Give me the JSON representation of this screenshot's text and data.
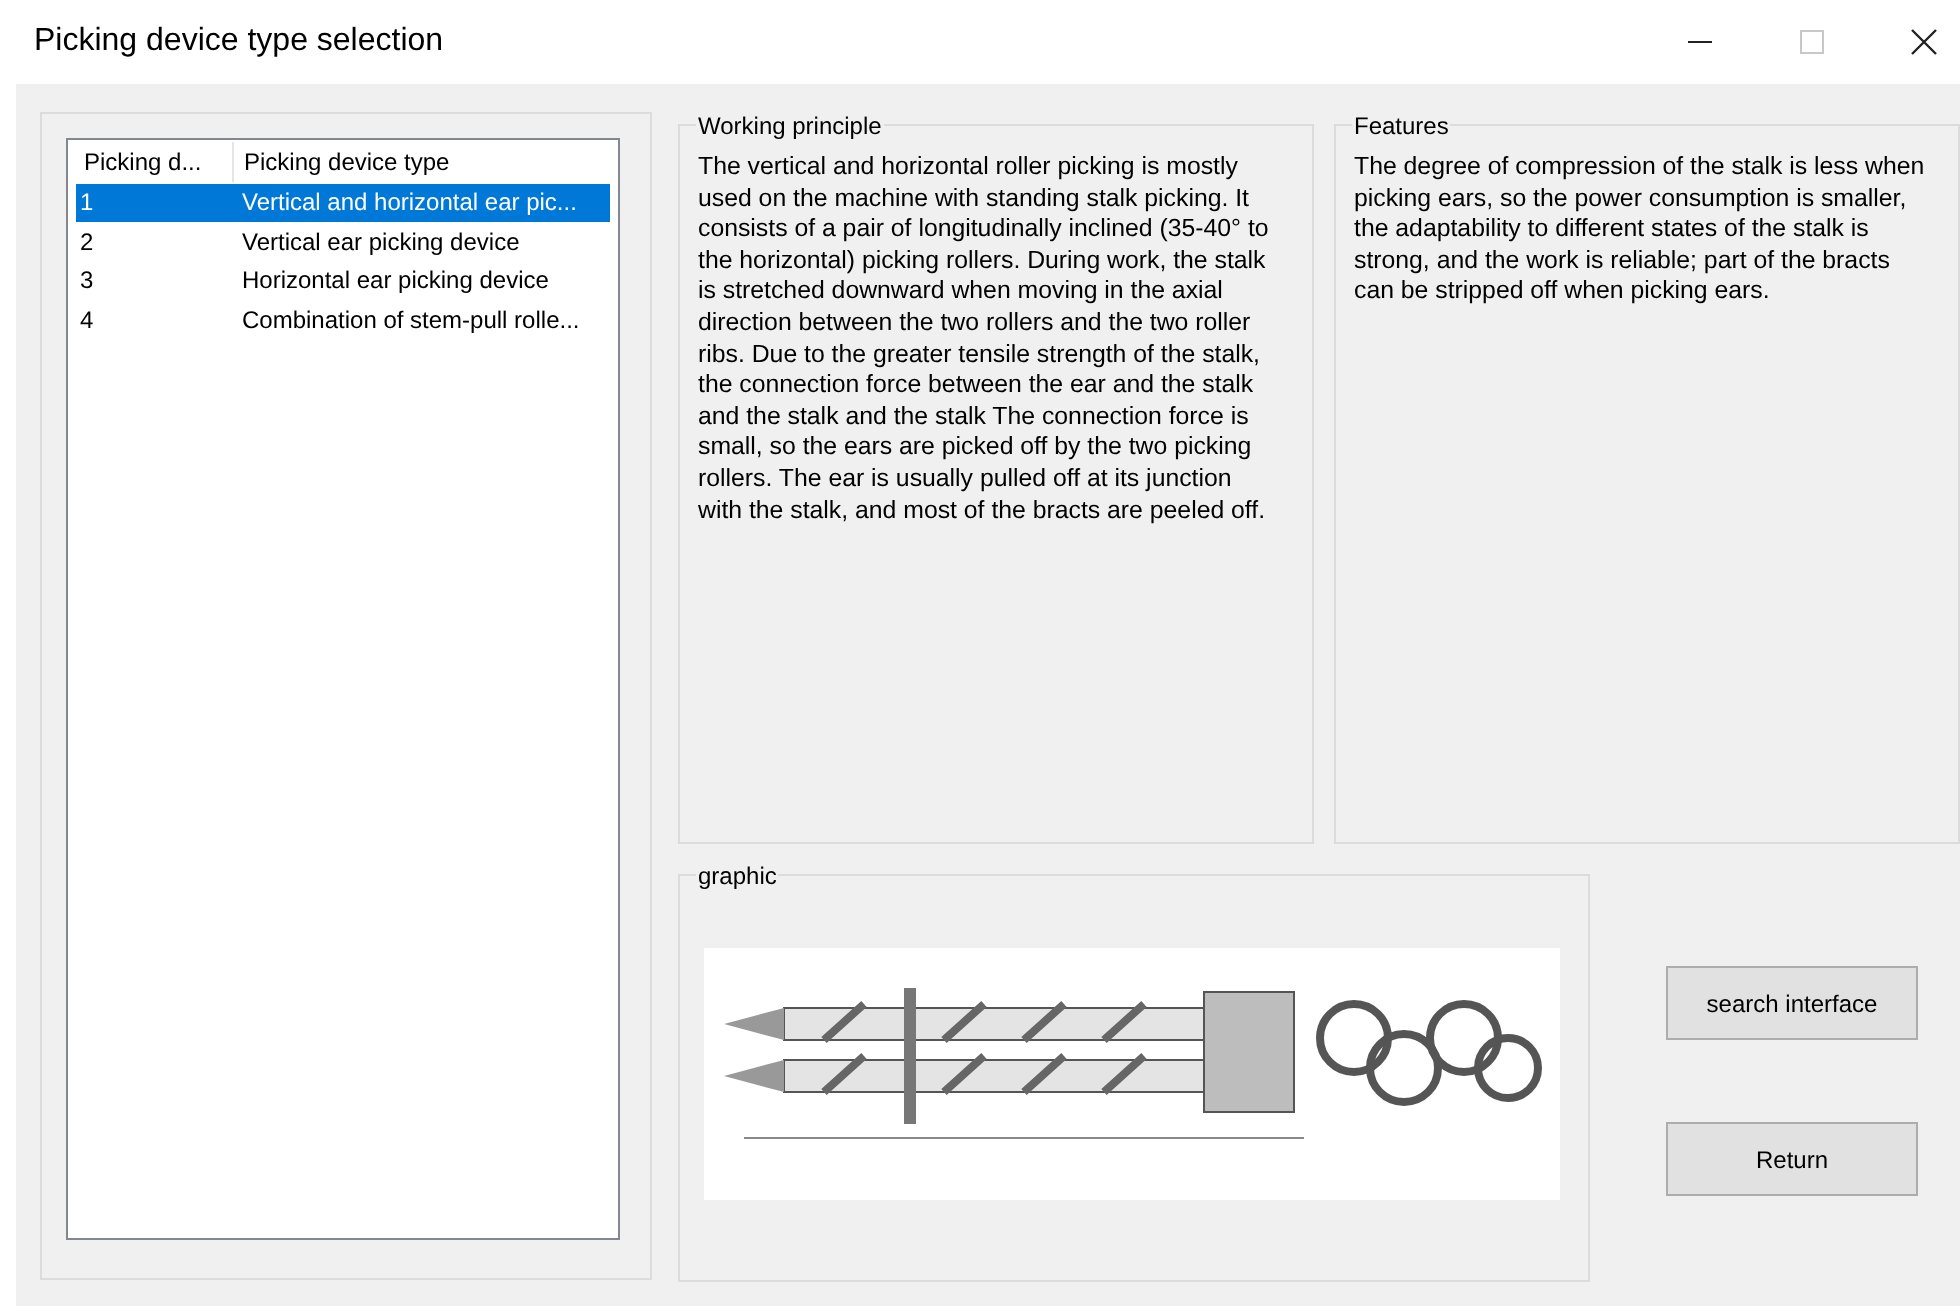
{
  "window": {
    "title": "Picking device type selection",
    "maximize_disabled": true
  },
  "device_list": {
    "columns": [
      "Picking d...",
      "Picking device type"
    ],
    "rows": [
      {
        "cells": [
          "1",
          "Vertical and horizontal ear pic..."
        ],
        "selected": true
      },
      {
        "cells": [
          "2",
          "Vertical ear picking device"
        ],
        "selected": false
      },
      {
        "cells": [
          "3",
          "Horizontal ear picking device"
        ],
        "selected": false
      },
      {
        "cells": [
          "4",
          "Combination of stem-pull rolle..."
        ],
        "selected": false
      }
    ]
  },
  "working_principle": {
    "title": "Working principle",
    "text": "The vertical and horizontal roller picking is mostly used on the machine with standing stalk picking. It consists of a pair of longitudinally inclined (35-40° to the horizontal) picking rollers. During work, the stalk is stretched downward when moving in the axial direction between the two rollers and the two roller ribs. Due to the greater tensile strength of the stalk, the connection force between the ear and the stalk and the stalk and the stalk The connection force is small, so the ears are picked off by the two picking rollers. The ear is usually pulled off at its junction with the stalk, and most of the bracts are peeled off."
  },
  "features": {
    "title": "Features",
    "text": "The degree of compression of the stalk is less when picking ears, so the power consumption is smaller, the adaptability to different states of the stalk is strong, and the work is reliable; part of the bracts can be stripped off when picking ears."
  },
  "graphic": {
    "title": "graphic"
  },
  "buttons": [
    "search interface",
    "Return"
  ]
}
